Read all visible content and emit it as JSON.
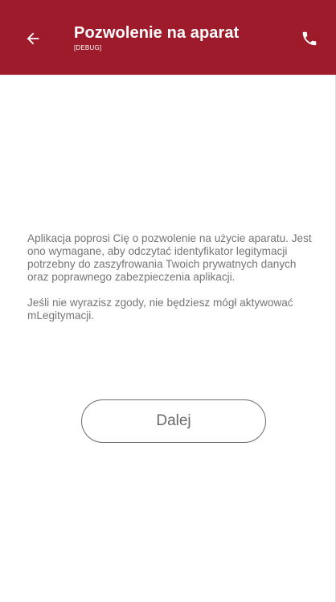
{
  "header": {
    "title": "Pozwolenie na aparat",
    "subtitle": "[DEBUG]",
    "back_icon": "arrow-back-icon",
    "call_icon": "phone-icon",
    "background_color": "#9e1b2b"
  },
  "main": {
    "paragraph_1": "Aplikacja poprosi Cię o pozwolenie na użycie aparatu. Jest ono wymagane, aby odczytać identyfikator legitymacji potrzebny do zaszyfrowania Twoich prywatnych danych oraz poprawnego zabezpieczenia aplikacji.",
    "paragraph_2": "Jeśli nie wyrazisz zgody, nie będziesz mógł aktywować mLegitymacji.",
    "next_button_label": "Dalej"
  }
}
